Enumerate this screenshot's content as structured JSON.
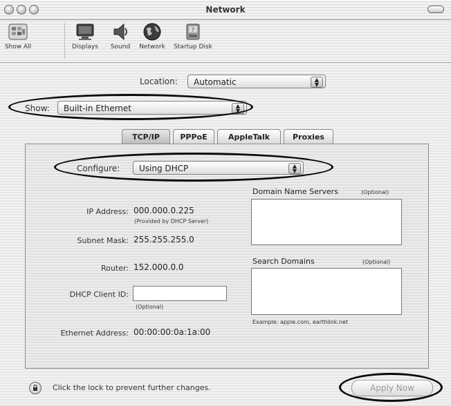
{
  "window": {
    "title": "Network"
  },
  "toolbar": {
    "items": [
      {
        "label": "Show All",
        "icon": "show-all-icon"
      },
      {
        "label": "Displays",
        "icon": "display-icon"
      },
      {
        "label": "Sound",
        "icon": "speaker-icon"
      },
      {
        "label": "Network",
        "icon": "globe-icon"
      },
      {
        "label": "Startup Disk",
        "icon": "disk-icon"
      }
    ]
  },
  "location": {
    "label": "Location:",
    "value": "Automatic"
  },
  "show": {
    "label": "Show:",
    "value": "Built-in Ethernet"
  },
  "tabs": [
    {
      "label": "TCP/IP",
      "selected": true
    },
    {
      "label": "PPPoE",
      "selected": false
    },
    {
      "label": "AppleTalk",
      "selected": false
    },
    {
      "label": "Proxies",
      "selected": false
    }
  ],
  "tcpip": {
    "configure_label": "Configure:",
    "configure_value": "Using DHCP",
    "ip_label": "IP Address:",
    "ip_value": "000.000.0.225",
    "ip_note": "(Provided by DHCP Server)",
    "subnet_label": "Subnet Mask:",
    "subnet_value": "255.255.255.0",
    "router_label": "Router:",
    "router_value": "152.000.0.0",
    "client_id_label": "DHCP Client ID:",
    "client_id_value": "",
    "client_id_note": "(Optional)",
    "ethernet_label": "Ethernet Address:",
    "ethernet_value": "00:00:00:0a:1a:00",
    "dns_label": "Domain Name Servers",
    "dns_optional": "(Optional)",
    "search_label": "Search Domains",
    "search_optional": "(Optional)",
    "example": "Example: apple.com, earthlink.net"
  },
  "footer": {
    "lock_text": "Click the lock to prevent further changes.",
    "apply_label": "Apply Now"
  }
}
